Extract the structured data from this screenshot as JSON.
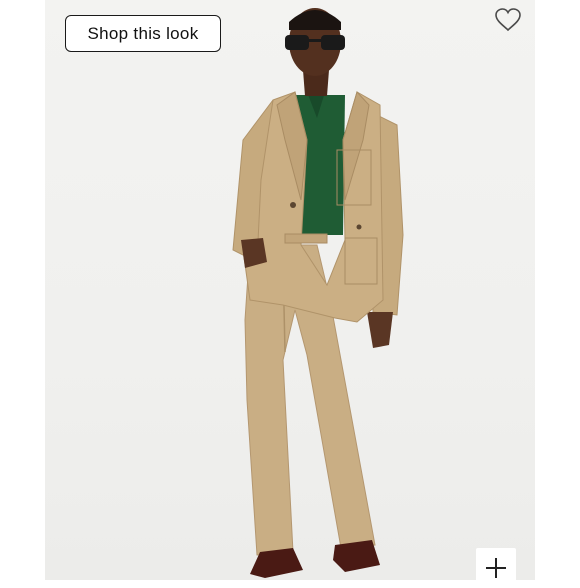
{
  "shop_button": {
    "label": "Shop this look"
  },
  "icons": {
    "favorite": "heart-outline-icon",
    "add": "plus-icon"
  },
  "colors": {
    "background": "#f0f0ee",
    "suit": "#c8ad82",
    "polo": "#1f5c34",
    "shoes": "#4a1a14"
  }
}
